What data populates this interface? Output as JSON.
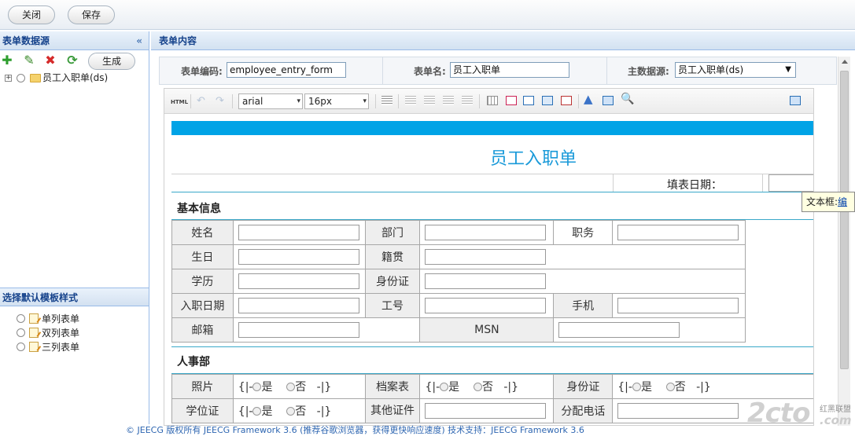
{
  "toolbar": {
    "close_label": "关闭",
    "save_label": "保存"
  },
  "left_panel": {
    "title": "表单数据源",
    "collapse_glyph": "«",
    "tools": {
      "add_icon": "add-icon",
      "edit_icon": "edit-icon",
      "delete_icon": "delete-icon",
      "refresh_icon": "refresh-icon"
    },
    "generate_label": "生成",
    "tree": [
      {
        "label": "员工入职单(ds)"
      }
    ],
    "template_title": "选择默认模板样式",
    "templates": [
      {
        "label": "单列表单"
      },
      {
        "label": "双列表单"
      },
      {
        "label": "三列表单"
      }
    ]
  },
  "right_panel": {
    "title": "表单内容",
    "meta": {
      "code_label": "表单编码:",
      "code_value": "employee_entry_form",
      "name_label": "表单名:",
      "name_value": "员工入职单",
      "ds_label": "主数据源:",
      "ds_value": "员工入职单(ds)"
    },
    "editor": {
      "html_label": "HTML",
      "font_family": "arial",
      "font_size": "16px",
      "form": {
        "title": "员工入职单",
        "date_label": "填表日期：",
        "section_basic": "基本信息",
        "section_hr": "人事部",
        "labels": {
          "name": "姓名",
          "dept": "部门",
          "position": "职务",
          "birthday": "生日",
          "origin": "籍贯",
          "education": "学历",
          "idcard": "身份证",
          "entry_date": "入职日期",
          "job_no": "工号",
          "mobile": "手机",
          "email": "邮箱",
          "msn": "MSN",
          "photo": "照片",
          "archive": "档案表",
          "idcard2": "身份证",
          "degree": "学位证",
          "other_cert": "其他证件",
          "assign_phone": "分配电话"
        },
        "radio_group": {
          "open": "{|-",
          "yes": "是",
          "no": "否",
          "close": "-|}"
        }
      }
    }
  },
  "tooltip": {
    "label": "文本框:",
    "link": "编"
  },
  "footer": "© JEECG 版权所有 JEECG Framework 3.6 (推荐谷歌浏览器，获得更快响应速度) 技术支持：JEECG Framework 3.6",
  "watermark": {
    "brand": "2cto",
    "suffix": ".com",
    "sub": "红黑联盟"
  }
}
